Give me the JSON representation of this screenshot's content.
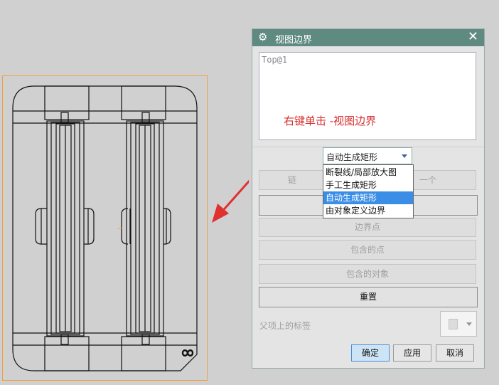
{
  "dialog": {
    "title": "视图边界",
    "views": [
      "Top@1"
    ],
    "annotation": "右键单击 -视图边界",
    "mode_select": {
      "selected": "自动生成矩形",
      "options": [
        "断裂线/局部放大图",
        "手工生成矩形",
        "自动生成矩形",
        "由对象定义边界"
      ]
    },
    "buttons": {
      "chain": "链",
      "cancel_prev_partial": "一个",
      "boundary_point": "边界点",
      "contained_points": "包含的点",
      "contained_objects": "包含的对象",
      "reset": "重置"
    },
    "parent_label": "父项上的标签",
    "footer": {
      "ok": "确定",
      "apply": "应用",
      "cancel": "取消"
    }
  },
  "colors": {
    "titlebar": "#5e8a80",
    "annotation": "#d83030",
    "selection": "#3a8ee6",
    "view_border": "#f0a040"
  },
  "icons": {
    "title": "gear-icon",
    "close": "close-icon",
    "infinity": "infinity-icon"
  }
}
